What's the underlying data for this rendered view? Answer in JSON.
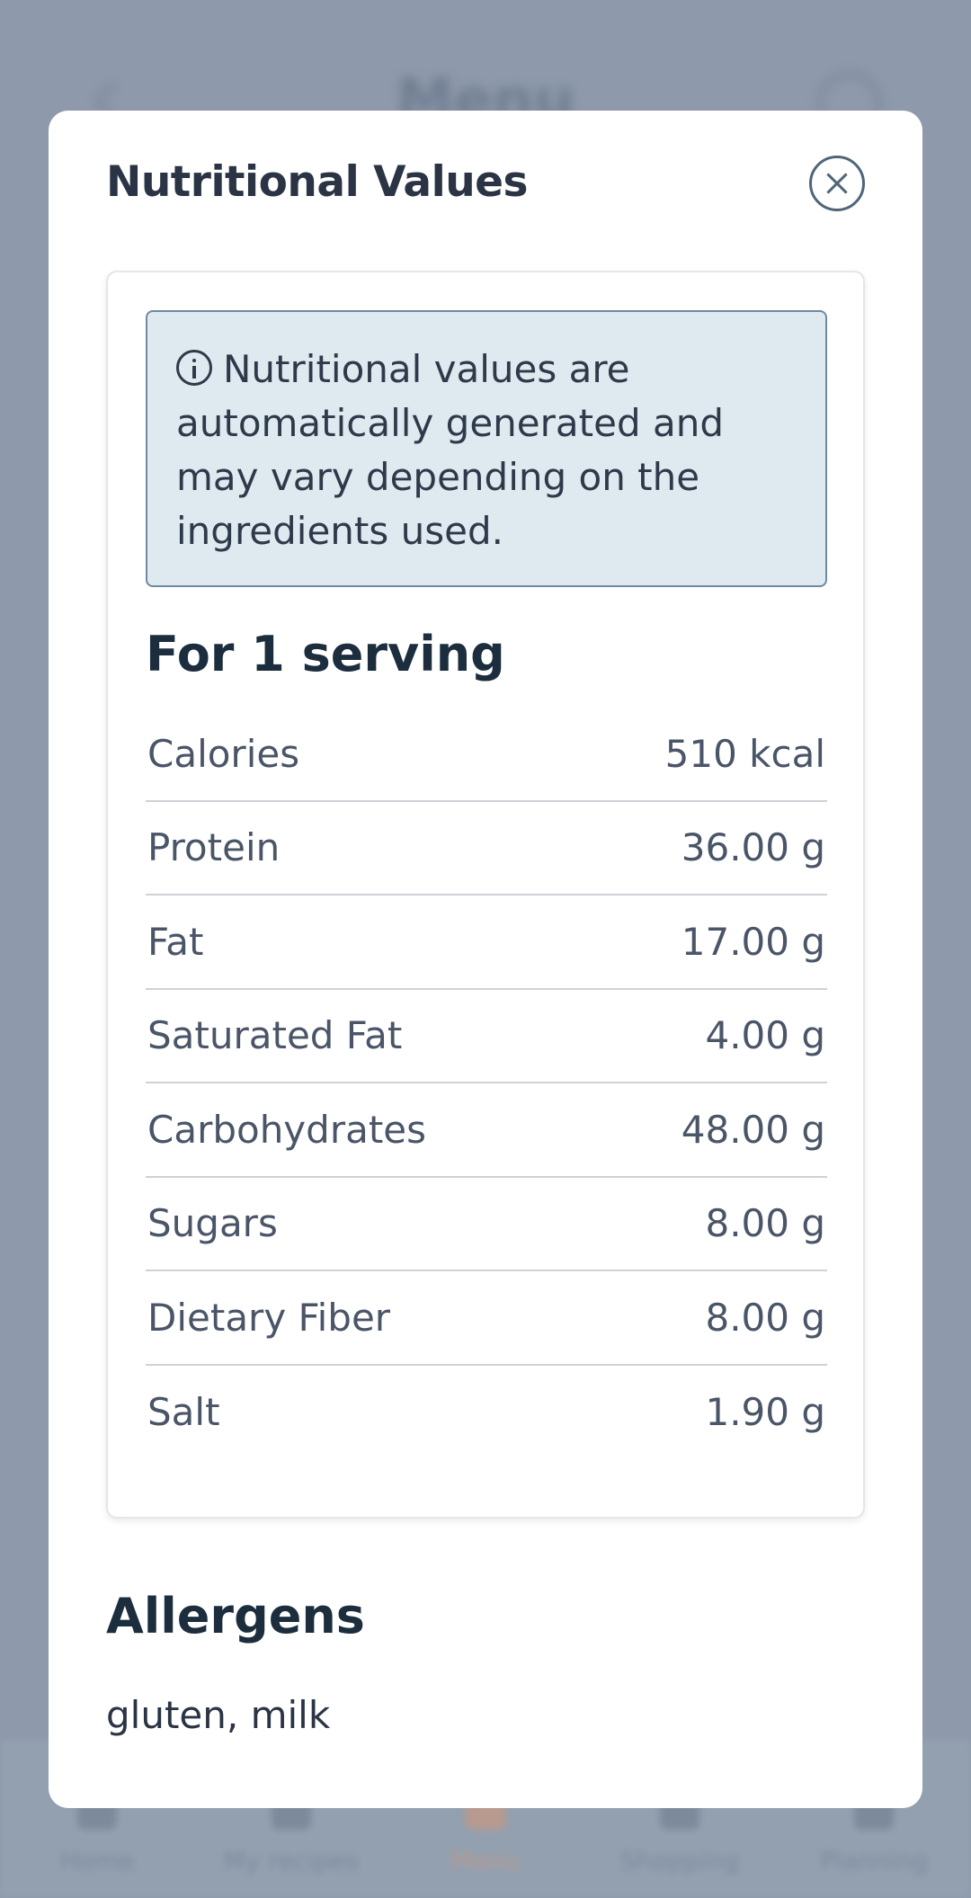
{
  "background": {
    "header_title": "Menu",
    "nav": [
      {
        "label": "Home",
        "active": false
      },
      {
        "label": "My recipes",
        "active": false
      },
      {
        "label": "Menu",
        "active": true
      },
      {
        "label": "Shopping",
        "active": false
      },
      {
        "label": "Planning",
        "active": false
      }
    ]
  },
  "modal": {
    "title": "Nutritional Values",
    "close_icon": "close-icon",
    "info_icon": "info-icon",
    "info_text": "Nutritional values are automatically generated and may vary depending on the ingredients used.",
    "serving_title": "For 1 serving",
    "nutrients": [
      {
        "name": "Calories",
        "value": "510 kcal"
      },
      {
        "name": "Protein",
        "value": "36.00 g"
      },
      {
        "name": "Fat",
        "value": "17.00 g"
      },
      {
        "name": "Saturated Fat",
        "value": "4.00 g"
      },
      {
        "name": "Carbohydrates",
        "value": "48.00 g"
      },
      {
        "name": "Sugars",
        "value": "8.00 g"
      },
      {
        "name": "Dietary Fiber",
        "value": "8.00 g"
      },
      {
        "name": "Salt",
        "value": "1.90 g"
      }
    ],
    "allergens_title": "Allergens",
    "allergens_text": "gluten, milk"
  },
  "colors": {
    "overlay": "#8e9aab",
    "info_bg": "#dfe9f0",
    "info_border": "#6e8aa0",
    "heading": "#1c2d3e"
  }
}
